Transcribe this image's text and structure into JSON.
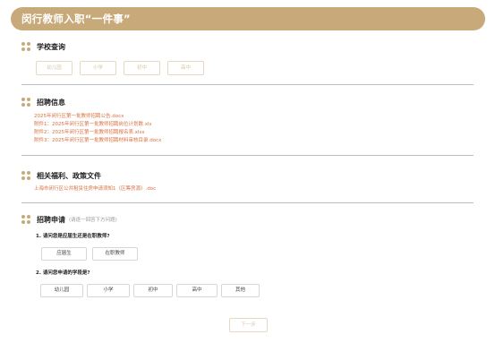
{
  "header": {
    "title": "闵行教师入职“一件事”"
  },
  "school_query": {
    "title": "学校查询",
    "buttons": [
      "幼儿园",
      "小学",
      "初中",
      "高中"
    ]
  },
  "recruit_info": {
    "title": "招聘信息",
    "links": [
      "2025年闵行区第一批教师招聘公告.docx",
      "附件1：2025年闵行区第一批教师招聘岗位计划数.xls",
      "附件2：2025年闵行区第一批教师招聘报名表.xlsx",
      "附件3：2025年闵行区第一批教师招聘材料审核目录.docx"
    ]
  },
  "welfare": {
    "title": "相关福利、政策文件",
    "links": [
      "上海市闵行区公共租赁住房申请须知1（区筹房源）.doc"
    ]
  },
  "apply": {
    "title": "招聘申请",
    "hint": "(请逐一回答下方问题)",
    "q1": {
      "text": "1. 请问您是应届生还是在职教师?",
      "options": [
        "应届生",
        "在职教师"
      ]
    },
    "q2": {
      "text": "2. 请问您申请的学段是?",
      "options": [
        "幼儿园",
        "小学",
        "初中",
        "高中",
        "其他"
      ]
    }
  },
  "next_button": "下一步"
}
